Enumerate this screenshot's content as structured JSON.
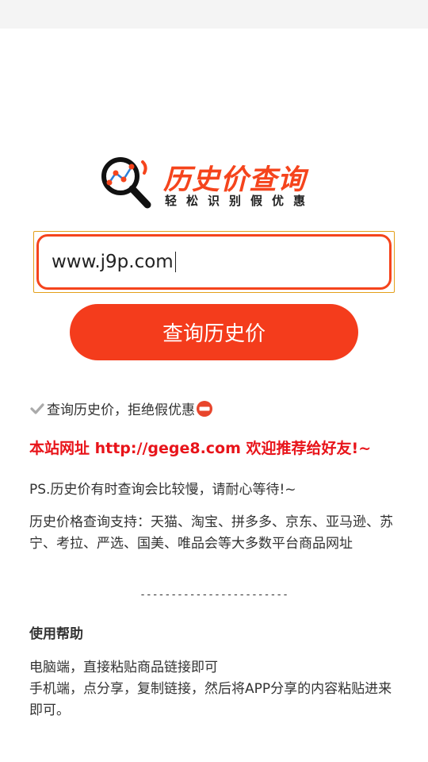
{
  "logo": {
    "title": "历史价查询",
    "subtitle": "轻松识别假优惠",
    "brand_color": "#f5441c"
  },
  "search": {
    "value": "www.j9p.com",
    "button_label": "查询历史价"
  },
  "info": {
    "tagline": "查询历史价，拒绝假优惠",
    "site_notice": "本站网址 http://gege8.com 欢迎推荐给好友!~",
    "ps_note": "PS.历史价有时查询会比较慢，请耐心等待!~",
    "support_text": "历史价格查询支持：天猫、淘宝、拼多多、京东、亚马逊、苏宁、考拉、严选、国美、唯品会等大多数平台商品网址",
    "divider": "------------------------"
  },
  "help": {
    "title": "使用帮助",
    "pc_text": "电脑端，直接粘贴商品链接即可",
    "mobile_text": "手机端，点分享，复制链接，然后将APP分享的内容粘贴进来即可。"
  },
  "icons": {
    "check": "check-icon",
    "no_entry": "no-entry-icon",
    "logo": "magnifier-chart-icon"
  }
}
